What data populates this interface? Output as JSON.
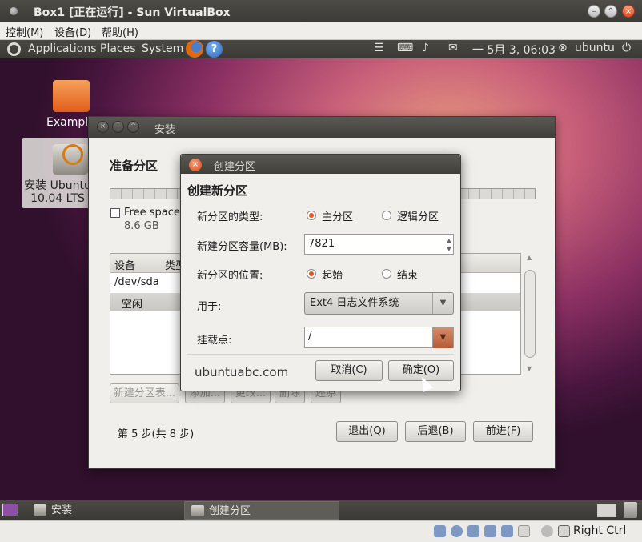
{
  "host": {
    "title": "Box1 [正在运行] - Sun VirtualBox",
    "menu": [
      "控制(M)",
      "设备(D)",
      "帮助(H)"
    ],
    "status_right": "Right Ctrl"
  },
  "guest_panel": {
    "menus": [
      "Applications",
      "Places",
      "System"
    ],
    "clock": "一 5月  3, 06:03",
    "user": "ubuntu"
  },
  "desktop_icons": [
    {
      "label": "Examples",
      "icon": "folder-icon"
    },
    {
      "label": "安装 Ubuntu 10.04 LTS",
      "icon": "installer-icon"
    }
  ],
  "installer": {
    "title": "安装",
    "heading": "准备分区",
    "free_space_label": "Free space",
    "free_space_size": "8.6 GB",
    "table_headers": [
      "设备",
      "类型"
    ],
    "table_rows": [
      {
        "device": "/dev/sda",
        "type": ""
      },
      {
        "device": "空闲",
        "type": ""
      }
    ],
    "action_buttons": [
      "新建分区表...",
      "添加...",
      "更改...",
      "删除",
      "还原"
    ],
    "step_text": "第 5 步(共 8 步)",
    "nav_buttons": {
      "quit": "退出(Q)",
      "back": "后退(B)",
      "forward": "前进(F)"
    }
  },
  "dialog": {
    "title": "创建分区",
    "heading": "创建新分区",
    "type_label": "新分区的类型:",
    "type_options": [
      {
        "label": "主分区",
        "selected": true
      },
      {
        "label": "逻辑分区",
        "selected": false
      }
    ],
    "size_label": "新建分区容量(MB):",
    "size_value": "7821",
    "position_label": "新分区的位置:",
    "position_options": [
      {
        "label": "起始",
        "selected": true
      },
      {
        "label": "结束",
        "selected": false
      }
    ],
    "use_label": "用于:",
    "use_value": "Ext4 日志文件系统",
    "mount_label": "挂载点:",
    "mount_value": "/",
    "watermark": "ubuntuabc.com",
    "cancel": "取消(C)",
    "ok": "确定(O)"
  },
  "taskbar": {
    "items": [
      "安装",
      "创建分区"
    ]
  },
  "colors": {
    "accent": "#e0541f",
    "panel": "#3c3b37",
    "window_bg": "#f1efeb"
  }
}
